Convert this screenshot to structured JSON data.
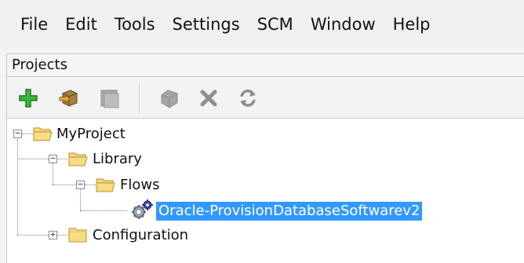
{
  "menubar": {
    "items": [
      "File",
      "Edit",
      "Tools",
      "Settings",
      "SCM",
      "Window",
      "Help"
    ]
  },
  "panel": {
    "title": "Projects"
  },
  "toolbar": {
    "buttons": [
      {
        "icon": "add-icon",
        "color": "#2ea12e"
      },
      {
        "icon": "import-icon",
        "color": "#8a6a2e"
      },
      {
        "icon": "copy-icon",
        "color": "#9a9a9a"
      },
      {
        "icon": "delete-icon",
        "color": "#9a9a9a"
      },
      {
        "icon": "close-icon",
        "color": "#8a8a8a"
      },
      {
        "icon": "refresh-icon",
        "color": "#8a8a8a"
      }
    ]
  },
  "tree": {
    "project": "MyProject",
    "library": "Library",
    "flows": "Flows",
    "flow_item": "Oracle-ProvisionDatabaseSoftwarev2",
    "configuration": "Configuration"
  },
  "colors": {
    "selection": "#3399ff",
    "folder": "#f3cf6b"
  }
}
